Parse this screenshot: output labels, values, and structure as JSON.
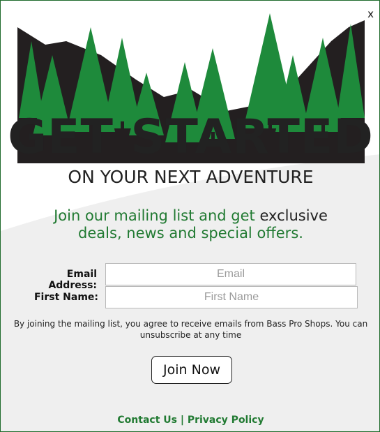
{
  "modal": {
    "close_label": "x",
    "headline": "GET STARTED",
    "subhead": "ON YOUR NEXT ADVENTURE",
    "promo_green": "Join our mailing list and get",
    "promo_dark": "exclusive",
    "promo_line2": "deals, news and special offers."
  },
  "form": {
    "email_label": "Email Address:",
    "email_placeholder": "Email",
    "first_name_label": "First Name:",
    "first_name_placeholder": "First Name",
    "legal": "By joining the mailing list, you agree to receive emails from Bass Pro Shops. You can unsubscribe at any time",
    "join_label": "Join Now"
  },
  "footer": {
    "contact_label": "Contact Us",
    "separator": "|",
    "privacy_label": "Privacy Policy"
  },
  "colors": {
    "brand_green": "#217a32",
    "tree_green": "#1e8a3b",
    "mountain": "#231f20",
    "swoosh": "#efefef"
  },
  "icons": {
    "close": "close-icon",
    "scene": "forest-mountain-illustration"
  }
}
